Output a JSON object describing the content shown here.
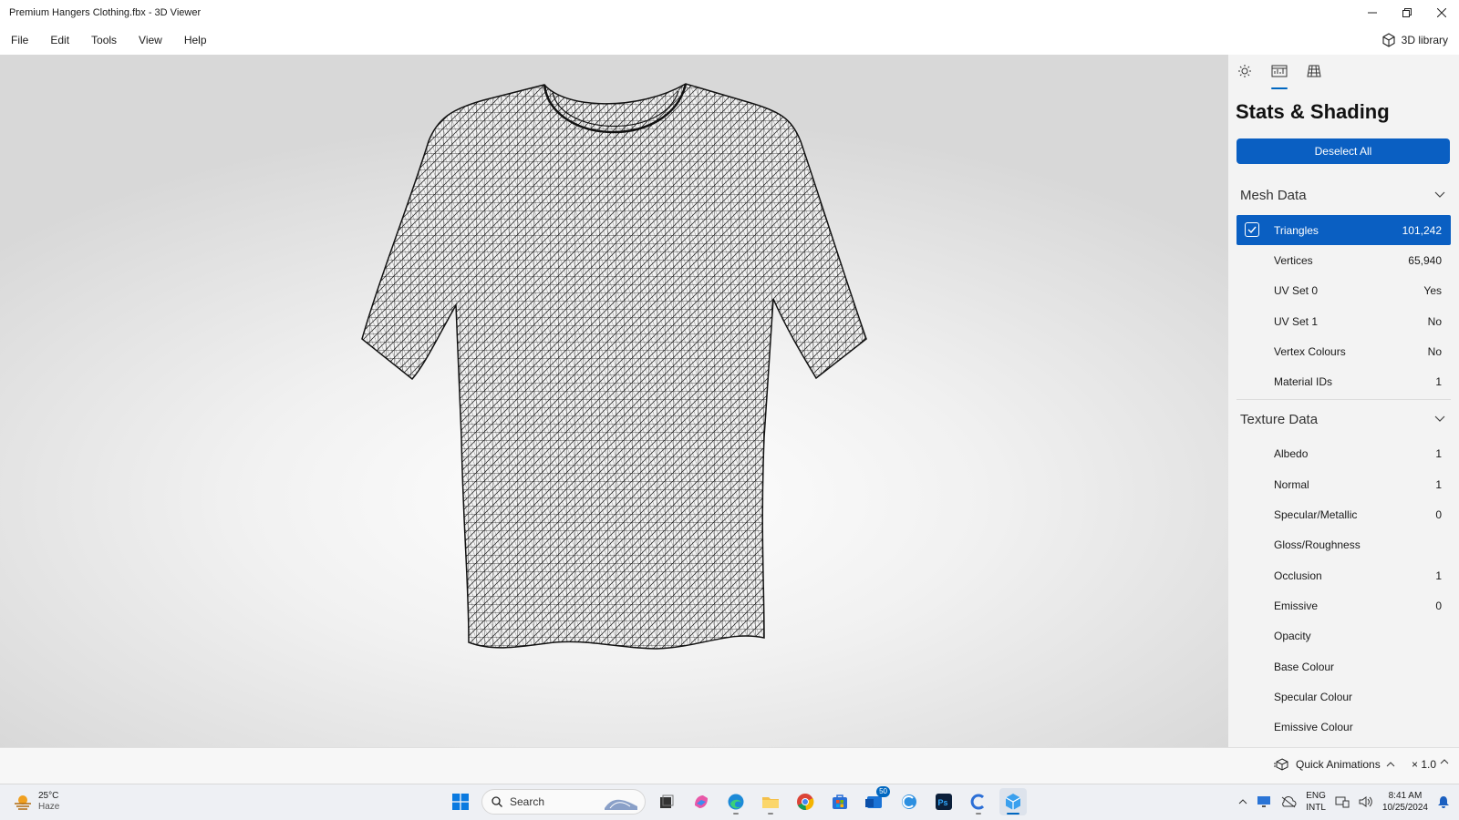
{
  "window": {
    "title": "Premium Hangers Clothing.fbx - 3D Viewer",
    "minimize_icon": "minimize-icon",
    "restore_icon": "restore-icon",
    "close_icon": "close-icon"
  },
  "menu": {
    "items": [
      "File",
      "Edit",
      "Tools",
      "View",
      "Help"
    ],
    "library_label": "3D library"
  },
  "panel": {
    "title": "Stats & Shading",
    "deselect_label": "Deselect All",
    "tabs": [
      "environment-lighting",
      "stats-shading",
      "grid"
    ],
    "mesh_section": "Mesh Data",
    "mesh_rows": [
      {
        "label": "Triangles",
        "value": "101,242",
        "selected": true
      },
      {
        "label": "Vertices",
        "value": "65,940"
      },
      {
        "label": "UV Set 0",
        "value": "Yes"
      },
      {
        "label": "UV Set 1",
        "value": "No"
      },
      {
        "label": "Vertex Colours",
        "value": "No"
      },
      {
        "label": "Material IDs",
        "value": "1"
      }
    ],
    "texture_section": "Texture Data",
    "texture_rows": [
      {
        "label": "Albedo",
        "value": "1"
      },
      {
        "label": "Normal",
        "value": "1"
      },
      {
        "label": "Specular/Metallic",
        "value": "0"
      },
      {
        "label": "Gloss/Roughness",
        "value": ""
      },
      {
        "label": "Occlusion",
        "value": "1"
      },
      {
        "label": "Emissive",
        "value": "0"
      },
      {
        "label": "Opacity",
        "value": ""
      },
      {
        "label": "Base Colour",
        "value": ""
      },
      {
        "label": "Specular Colour",
        "value": ""
      },
      {
        "label": "Emissive Colour",
        "value": ""
      }
    ]
  },
  "status": {
    "quick_animations": "Quick Animations",
    "speed": "× 1.0"
  },
  "taskbar": {
    "weather_temp": "25°C",
    "weather_desc": "Haze",
    "search_placeholder": "Search",
    "mail_badge": "50",
    "lang_line1": "ENG",
    "lang_line2": "INTL",
    "time": "8:41 AM",
    "date": "10/25/2024"
  },
  "colors": {
    "accent": "#0a5fc2"
  }
}
